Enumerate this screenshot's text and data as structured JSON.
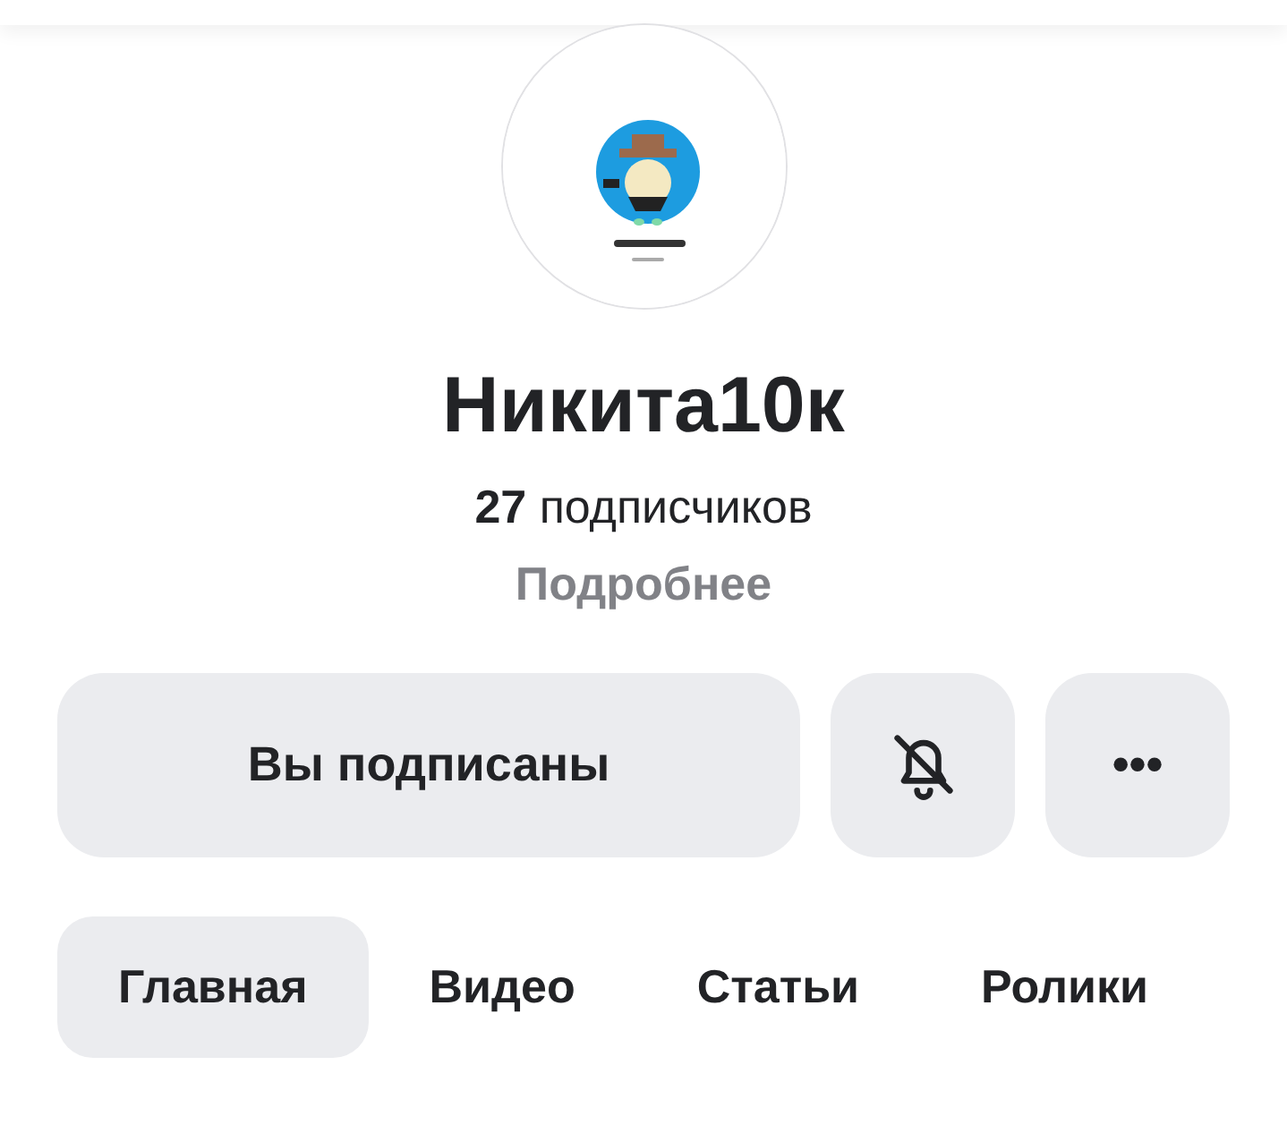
{
  "profile": {
    "name": "Никита10к",
    "subscribers_count": "27",
    "subscribers_label": "подписчиков",
    "more_link": "Подробнее"
  },
  "actions": {
    "subscribe_button": "Вы подписаны",
    "notifications_muted": true,
    "more_button": "•••"
  },
  "tabs": [
    {
      "label": "Главная",
      "selected": true
    },
    {
      "label": "Видео",
      "selected": false
    },
    {
      "label": "Статьи",
      "selected": false
    },
    {
      "label": "Ролики",
      "selected": false
    }
  ]
}
